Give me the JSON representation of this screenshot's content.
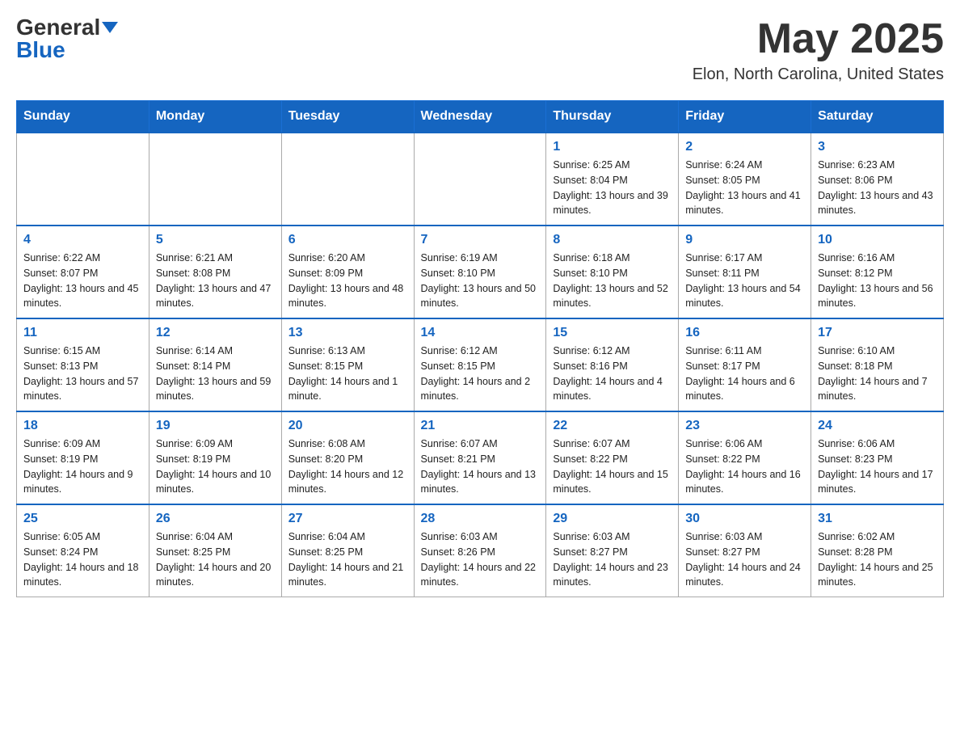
{
  "header": {
    "logo_general": "General",
    "logo_blue": "Blue",
    "month_title": "May 2025",
    "location": "Elon, North Carolina, United States"
  },
  "weekdays": [
    "Sunday",
    "Monday",
    "Tuesday",
    "Wednesday",
    "Thursday",
    "Friday",
    "Saturday"
  ],
  "weeks": [
    [
      {
        "day": "",
        "info": ""
      },
      {
        "day": "",
        "info": ""
      },
      {
        "day": "",
        "info": ""
      },
      {
        "day": "",
        "info": ""
      },
      {
        "day": "1",
        "info": "Sunrise: 6:25 AM\nSunset: 8:04 PM\nDaylight: 13 hours and 39 minutes."
      },
      {
        "day": "2",
        "info": "Sunrise: 6:24 AM\nSunset: 8:05 PM\nDaylight: 13 hours and 41 minutes."
      },
      {
        "day": "3",
        "info": "Sunrise: 6:23 AM\nSunset: 8:06 PM\nDaylight: 13 hours and 43 minutes."
      }
    ],
    [
      {
        "day": "4",
        "info": "Sunrise: 6:22 AM\nSunset: 8:07 PM\nDaylight: 13 hours and 45 minutes."
      },
      {
        "day": "5",
        "info": "Sunrise: 6:21 AM\nSunset: 8:08 PM\nDaylight: 13 hours and 47 minutes."
      },
      {
        "day": "6",
        "info": "Sunrise: 6:20 AM\nSunset: 8:09 PM\nDaylight: 13 hours and 48 minutes."
      },
      {
        "day": "7",
        "info": "Sunrise: 6:19 AM\nSunset: 8:10 PM\nDaylight: 13 hours and 50 minutes."
      },
      {
        "day": "8",
        "info": "Sunrise: 6:18 AM\nSunset: 8:10 PM\nDaylight: 13 hours and 52 minutes."
      },
      {
        "day": "9",
        "info": "Sunrise: 6:17 AM\nSunset: 8:11 PM\nDaylight: 13 hours and 54 minutes."
      },
      {
        "day": "10",
        "info": "Sunrise: 6:16 AM\nSunset: 8:12 PM\nDaylight: 13 hours and 56 minutes."
      }
    ],
    [
      {
        "day": "11",
        "info": "Sunrise: 6:15 AM\nSunset: 8:13 PM\nDaylight: 13 hours and 57 minutes."
      },
      {
        "day": "12",
        "info": "Sunrise: 6:14 AM\nSunset: 8:14 PM\nDaylight: 13 hours and 59 minutes."
      },
      {
        "day": "13",
        "info": "Sunrise: 6:13 AM\nSunset: 8:15 PM\nDaylight: 14 hours and 1 minute."
      },
      {
        "day": "14",
        "info": "Sunrise: 6:12 AM\nSunset: 8:15 PM\nDaylight: 14 hours and 2 minutes."
      },
      {
        "day": "15",
        "info": "Sunrise: 6:12 AM\nSunset: 8:16 PM\nDaylight: 14 hours and 4 minutes."
      },
      {
        "day": "16",
        "info": "Sunrise: 6:11 AM\nSunset: 8:17 PM\nDaylight: 14 hours and 6 minutes."
      },
      {
        "day": "17",
        "info": "Sunrise: 6:10 AM\nSunset: 8:18 PM\nDaylight: 14 hours and 7 minutes."
      }
    ],
    [
      {
        "day": "18",
        "info": "Sunrise: 6:09 AM\nSunset: 8:19 PM\nDaylight: 14 hours and 9 minutes."
      },
      {
        "day": "19",
        "info": "Sunrise: 6:09 AM\nSunset: 8:19 PM\nDaylight: 14 hours and 10 minutes."
      },
      {
        "day": "20",
        "info": "Sunrise: 6:08 AM\nSunset: 8:20 PM\nDaylight: 14 hours and 12 minutes."
      },
      {
        "day": "21",
        "info": "Sunrise: 6:07 AM\nSunset: 8:21 PM\nDaylight: 14 hours and 13 minutes."
      },
      {
        "day": "22",
        "info": "Sunrise: 6:07 AM\nSunset: 8:22 PM\nDaylight: 14 hours and 15 minutes."
      },
      {
        "day": "23",
        "info": "Sunrise: 6:06 AM\nSunset: 8:22 PM\nDaylight: 14 hours and 16 minutes."
      },
      {
        "day": "24",
        "info": "Sunrise: 6:06 AM\nSunset: 8:23 PM\nDaylight: 14 hours and 17 minutes."
      }
    ],
    [
      {
        "day": "25",
        "info": "Sunrise: 6:05 AM\nSunset: 8:24 PM\nDaylight: 14 hours and 18 minutes."
      },
      {
        "day": "26",
        "info": "Sunrise: 6:04 AM\nSunset: 8:25 PM\nDaylight: 14 hours and 20 minutes."
      },
      {
        "day": "27",
        "info": "Sunrise: 6:04 AM\nSunset: 8:25 PM\nDaylight: 14 hours and 21 minutes."
      },
      {
        "day": "28",
        "info": "Sunrise: 6:03 AM\nSunset: 8:26 PM\nDaylight: 14 hours and 22 minutes."
      },
      {
        "day": "29",
        "info": "Sunrise: 6:03 AM\nSunset: 8:27 PM\nDaylight: 14 hours and 23 minutes."
      },
      {
        "day": "30",
        "info": "Sunrise: 6:03 AM\nSunset: 8:27 PM\nDaylight: 14 hours and 24 minutes."
      },
      {
        "day": "31",
        "info": "Sunrise: 6:02 AM\nSunset: 8:28 PM\nDaylight: 14 hours and 25 minutes."
      }
    ]
  ]
}
